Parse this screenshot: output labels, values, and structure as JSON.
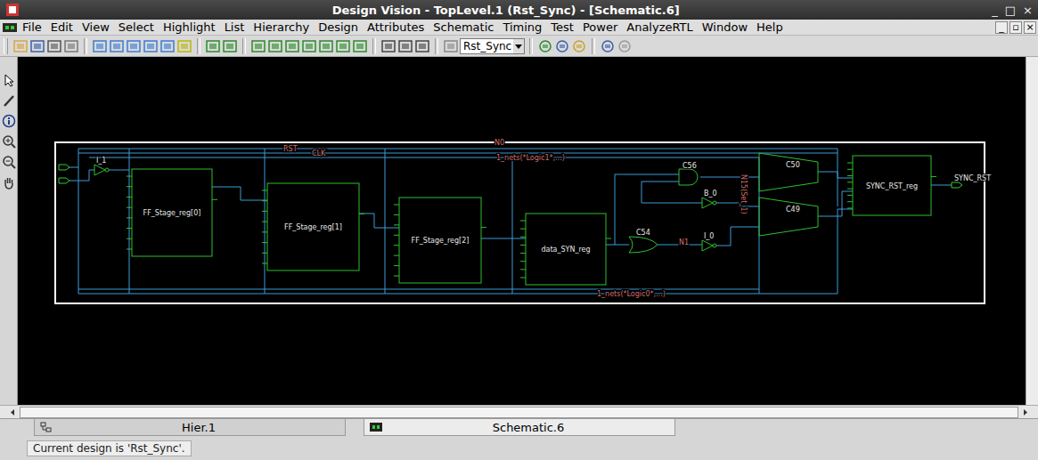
{
  "window": {
    "title": "Design Vision - TopLevel.1 (Rst_Sync) - [Schematic.6]",
    "controls": [
      "_",
      "□",
      "×"
    ]
  },
  "menu_bar": {
    "items": [
      "File",
      "Edit",
      "View",
      "Select",
      "Highlight",
      "List",
      "Hierarchy",
      "Design",
      "Attributes",
      "Schematic",
      "Timing",
      "Test",
      "Power",
      "AnalyzeRTL",
      "Window",
      "Help"
    ],
    "mdi_controls": [
      "_",
      "▫",
      "×"
    ]
  },
  "toolbar": {
    "design_selector": "Rst_Sync"
  },
  "schematic": {
    "registers": [
      {
        "name": "FF_Stage_reg[0]"
      },
      {
        "name": "FF_Stage_reg[1]"
      },
      {
        "name": "FF_Stage_reg[2]"
      },
      {
        "name": "data_SYN_reg"
      },
      {
        "name": "SYNC_RST_reg"
      }
    ],
    "muxes": [
      {
        "name": "C50"
      },
      {
        "name": "C49"
      }
    ],
    "gates": [
      {
        "name": "C56",
        "kind": "and"
      },
      {
        "name": "B_0",
        "kind": "inv"
      },
      {
        "name": "C54",
        "kind": "or"
      },
      {
        "name": "I_0",
        "kind": "inv"
      },
      {
        "name": "I_1",
        "kind": "inv"
      }
    ],
    "nets": [
      "RST",
      "CLK",
      "N0",
      "1_nets(*Logic1*,...)",
      "1_nets(*Logic0*,...)",
      "N1",
      "N15(Set_1)"
    ],
    "output_port": "SYNC_RST"
  },
  "tabs": [
    {
      "label": "Hier.1",
      "selected": false
    },
    {
      "label": "Schematic.6",
      "selected": true
    }
  ],
  "status_bar": {
    "text": "Current design is 'Rst_Sync'."
  }
}
